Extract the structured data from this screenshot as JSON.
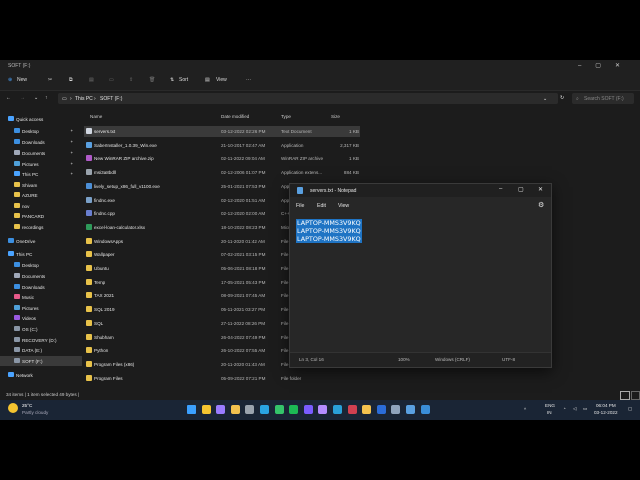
{
  "explorer": {
    "window_title": "SOFT (F:)",
    "toolbar": {
      "new_label": "New",
      "sort_label": "Sort",
      "view_label": "View",
      "more_label": "···"
    },
    "breadcrumb": [
      "This PC",
      "SOFT (F:)"
    ],
    "search_placeholder": "Search SOFT (F:)",
    "columns": {
      "name": "Name",
      "date": "Date modified",
      "type": "Type",
      "size": "Size"
    },
    "files": [
      {
        "name": "servers.txt",
        "date": "03-12-2022 02:26 PM",
        "type": "Text Document",
        "size": "1 KB",
        "icon": "text-file",
        "color": "#d0d6e0"
      },
      {
        "name": "SaberInstaller_1.0.39_Win.exe",
        "date": "21-10-2017 02:47 AM",
        "type": "Application",
        "size": "2,317 KB",
        "icon": "exe",
        "color": "#5aa0e0"
      },
      {
        "name": "New WinRAR ZIP archive.zip",
        "date": "02-11-2022 09:04 AM",
        "type": "WinRAR ZIP archive",
        "size": "1 KB",
        "icon": "archive",
        "color": "#b05ac8"
      },
      {
        "name": "msi3a8bdll",
        "date": "02-12-2006 01:07 PM",
        "type": "Application extens...",
        "size": "884 KB",
        "icon": "dll",
        "color": "#9aa3ad"
      },
      {
        "name": "lively_setup_x86_full_v1100.exe",
        "date": "25-01-2021 07:53 PM",
        "type": "Application",
        "size": "",
        "icon": "exe",
        "color": "#4c8fd6"
      },
      {
        "name": "findnc.exe",
        "date": "02-12-2020 01:51 AM",
        "type": "Application",
        "size": "",
        "icon": "exe",
        "color": "#7aa0c8"
      },
      {
        "name": "findnc.cpp",
        "date": "02-12-2020 02:00 AM",
        "type": "C++",
        "size": "",
        "icon": "cpp",
        "color": "#6a7fd0"
      },
      {
        "name": "excel-loan-calculator.xlsx",
        "date": "18-10-2022 08:23 PM",
        "type": "Micro",
        "size": "",
        "icon": "excel",
        "color": "#2e9a5a"
      },
      {
        "name": "WindowsApps",
        "date": "20-11-2020 01:42 AM",
        "type": "File",
        "size": "",
        "icon": "folder",
        "color": "#e8c24a"
      },
      {
        "name": "Wallpaper",
        "date": "07-02-2021 03:15 PM",
        "type": "File",
        "size": "",
        "icon": "folder",
        "color": "#e8c24a"
      },
      {
        "name": "Ubuntu",
        "date": "05-06-2021 08:18 PM",
        "type": "File",
        "size": "",
        "icon": "folder",
        "color": "#e8c24a"
      },
      {
        "name": "Temp",
        "date": "17-05-2021 05:43 PM",
        "type": "File",
        "size": "",
        "icon": "folder",
        "color": "#e8c24a"
      },
      {
        "name": "TAX 2021",
        "date": "08-09-2021 07:45 AM",
        "type": "File",
        "size": "",
        "icon": "folder",
        "color": "#e8c24a"
      },
      {
        "name": "SQL 2019",
        "date": "05-11-2021 03:27 PM",
        "type": "File",
        "size": "",
        "icon": "folder",
        "color": "#e8c24a"
      },
      {
        "name": "SQL",
        "date": "27-11-2022 08:26 PM",
        "type": "File",
        "size": "",
        "icon": "folder",
        "color": "#e8c24a"
      },
      {
        "name": "Shubham",
        "date": "26-04-2022 07:49 PM",
        "type": "File",
        "size": "",
        "icon": "folder",
        "color": "#e8c24a"
      },
      {
        "name": "Python",
        "date": "26-10-2022 07:55 AM",
        "type": "File",
        "size": "",
        "icon": "folder",
        "color": "#e8c24a"
      },
      {
        "name": "Program Files (x86)",
        "date": "20-11-2020 01:43 AM",
        "type": "File folder",
        "size": "",
        "icon": "folder",
        "color": "#e8c24a"
      },
      {
        "name": "Program Files",
        "date": "05-09-2022 07:21 PM",
        "type": "File folder",
        "size": "",
        "icon": "folder",
        "color": "#e8c24a"
      }
    ],
    "sidebar": [
      {
        "label": "Quick access",
        "icon": "star",
        "color": "#4aa3ff",
        "indent": 0
      },
      {
        "label": "Desktop",
        "icon": "desktop",
        "color": "#3c8fe0",
        "indent": 1,
        "pinned": true
      },
      {
        "label": "Downloads",
        "icon": "download",
        "color": "#3c8fe0",
        "indent": 1,
        "pinned": true
      },
      {
        "label": "Documents",
        "icon": "document",
        "color": "#a0a8b8",
        "indent": 1,
        "pinned": true
      },
      {
        "label": "Pictures",
        "icon": "pictures",
        "color": "#4fa0d8",
        "indent": 1,
        "pinned": true
      },
      {
        "label": "This PC",
        "icon": "pc",
        "color": "#4aa3ff",
        "indent": 1,
        "pinned": true
      },
      {
        "label": "Shivam",
        "icon": "folder",
        "color": "#e8c24a",
        "indent": 1
      },
      {
        "label": "AZURE",
        "icon": "folder",
        "color": "#e8c24a",
        "indent": 1
      },
      {
        "label": "nov",
        "icon": "folder",
        "color": "#e8c24a",
        "indent": 1
      },
      {
        "label": "PANCARD",
        "icon": "folder",
        "color": "#e8c24a",
        "indent": 1
      },
      {
        "label": "recordings",
        "icon": "folder",
        "color": "#e8c24a",
        "indent": 1
      },
      {
        "label": "OneDrive",
        "icon": "cloud",
        "color": "#3c8fe0",
        "indent": 0
      },
      {
        "label": "This PC",
        "icon": "pc",
        "color": "#4aa3ff",
        "indent": 0
      },
      {
        "label": "Desktop",
        "icon": "desktop",
        "color": "#3c8fe0",
        "indent": 1
      },
      {
        "label": "Documents",
        "icon": "document",
        "color": "#a0a8b8",
        "indent": 1
      },
      {
        "label": "Downloads",
        "icon": "download",
        "color": "#3c8fe0",
        "indent": 1
      },
      {
        "label": "Music",
        "icon": "music",
        "color": "#e85a8a",
        "indent": 1
      },
      {
        "label": "Pictures",
        "icon": "pictures",
        "color": "#4fa0d8",
        "indent": 1
      },
      {
        "label": "Videos",
        "icon": "videos",
        "color": "#9a5ae0",
        "indent": 1
      },
      {
        "label": "OS (C:)",
        "icon": "drive",
        "color": "#8a96a6",
        "indent": 1
      },
      {
        "label": "RECOVERY (D:)",
        "icon": "drive",
        "color": "#8a96a6",
        "indent": 1
      },
      {
        "label": "DATA (E:)",
        "icon": "drive",
        "color": "#8a96a6",
        "indent": 1
      },
      {
        "label": "SOFT (F:)",
        "icon": "drive",
        "color": "#8a96a6",
        "indent": 1,
        "selected": true
      },
      {
        "label": "Network",
        "icon": "network",
        "color": "#4aa3ff",
        "indent": 0
      }
    ],
    "status": "34 items  |  1 item selected  49 bytes  |"
  },
  "notepad": {
    "title": "servers.txt - Notepad",
    "menu": [
      "File",
      "Edit",
      "View"
    ],
    "lines": [
      "LAPTOP-MMS3V9KQ",
      "LAPTOP-MMS3V9KQ",
      "LAPTOP-MMS3V9KQ"
    ],
    "status": {
      "position": "Ln 3, Col 16",
      "zoom": "100%",
      "line_ending": "Windows (CRLF)",
      "encoding": "UTF-8"
    }
  },
  "taskbar": {
    "weather_temp": "25°C",
    "weather_desc": "Partly cloudy",
    "lang": "ENG",
    "region": "IN",
    "time": "06:04 PM",
    "date": "03-12-2022",
    "apps": [
      {
        "name": "start",
        "color": "#3ba0ff"
      },
      {
        "name": "chrome",
        "color": "#f4c430"
      },
      {
        "name": "premiere",
        "color": "#9a7cff"
      },
      {
        "name": "file-explorer",
        "color": "#f2c14e"
      },
      {
        "name": "settings",
        "color": "#9aa3ad"
      },
      {
        "name": "telegram",
        "color": "#2aa3e0"
      },
      {
        "name": "whatsapp",
        "color": "#35c46a"
      },
      {
        "name": "spotify",
        "color": "#1db954"
      },
      {
        "name": "photos",
        "color": "#7a5cff"
      },
      {
        "name": "after-effects",
        "color": "#b48cff"
      },
      {
        "name": "edge",
        "color": "#2aa0d8"
      },
      {
        "name": "obs",
        "color": "#d04050"
      },
      {
        "name": "explorer",
        "color": "#f2c14e"
      },
      {
        "name": "word",
        "color": "#2b6cd8"
      },
      {
        "name": "search",
        "color": "#8fa3bb"
      },
      {
        "name": "notepad",
        "color": "#5aa0e0"
      },
      {
        "name": "store",
        "color": "#3a8ed8"
      }
    ]
  }
}
